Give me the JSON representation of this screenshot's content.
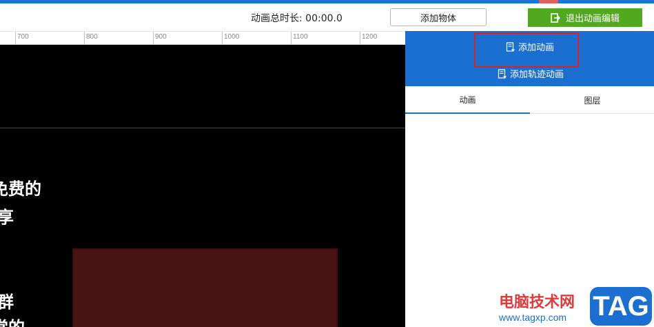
{
  "toolbar": {
    "duration_label": "动画总时长: 00:00.0",
    "add_object": "添加物体",
    "exit_edit": "退出动画编辑"
  },
  "ruler": {
    "ticks": [
      "700",
      "800",
      "900",
      "1000",
      "1100",
      "1200"
    ]
  },
  "canvas": {
    "lines": [
      "免费的",
      "享",
      "群",
      "常的"
    ]
  },
  "panel": {
    "add_animation": "添加动画",
    "add_path_animation": "添加轨迹动画",
    "tabs": [
      "动画",
      "图层"
    ]
  },
  "watermark": {
    "site_name": "电脑技术网",
    "url": "www.tagxp.com",
    "badge": "TAG"
  },
  "colors": {
    "accent": "#1a6fd0",
    "exit_button": "#52a81e",
    "highlight": "#e02020"
  }
}
